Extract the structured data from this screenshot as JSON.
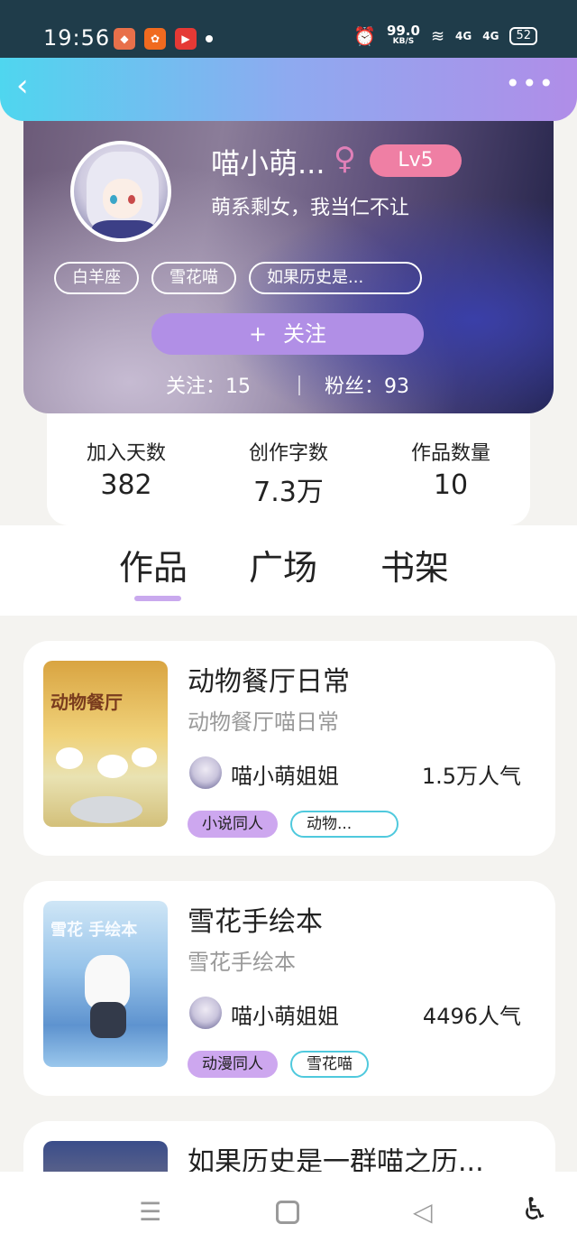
{
  "status_bar": {
    "time": "19:56",
    "net_speed": "99.0",
    "net_unit": "KB/S",
    "signal1": "4G",
    "signal2": "4G",
    "battery": "52"
  },
  "nav": {
    "back_icon": "‹",
    "more_icon": "•••"
  },
  "profile": {
    "name": "喵小萌...",
    "gender_icon": "♀",
    "level": "Lv5",
    "signature": "萌系剩女，我当仁不让",
    "tags": [
      "白羊座",
      "雪花喵",
      "如果历史是..."
    ],
    "follow_plus": "+",
    "follow_label": "关注",
    "following": "关注：15",
    "fans": "粉丝：93"
  },
  "stats": [
    {
      "label": "加入天数",
      "value": "382"
    },
    {
      "label": "创作字数",
      "value": "7.3万"
    },
    {
      "label": "作品数量",
      "value": "10"
    }
  ],
  "tabs": [
    "作品",
    "广场",
    "书架"
  ],
  "works": [
    {
      "title": "动物餐厅日常",
      "subtitle": "动物餐厅喵日常",
      "cover_text": "动物餐厅",
      "author": "喵小萌姐姐",
      "popularity": "1.5万人气",
      "tags": [
        "小说同人",
        "动物..."
      ]
    },
    {
      "title": "雪花手绘本",
      "subtitle": "雪花手绘本",
      "cover_text": "雪花 手绘本",
      "author": "喵小萌姐姐",
      "popularity": "4496人气",
      "tags": [
        "动漫同人",
        "雪花喵"
      ]
    },
    {
      "title": "如果历史是一群喵之历...",
      "cover_text": ""
    }
  ],
  "sys_nav": {
    "menu_icon": "☰",
    "back_icon": "◁",
    "accessibility_icon": "♿"
  }
}
